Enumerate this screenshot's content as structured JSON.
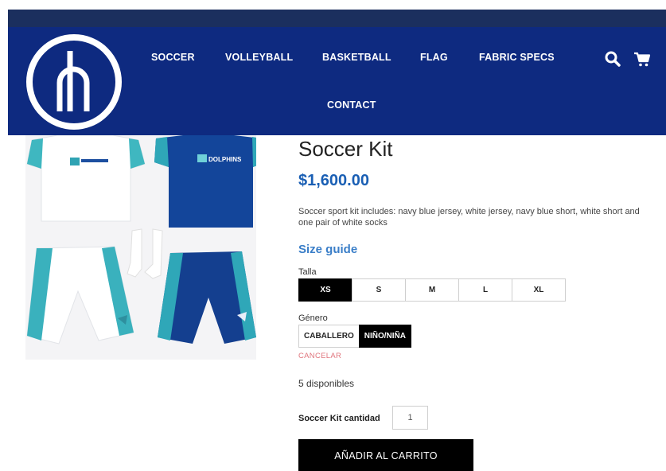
{
  "header": {
    "nav": [
      "SOCCER",
      "VOLLEYBALL",
      "BASKETBALL",
      "FLAG",
      "FABRIC SPECS",
      "CONTACT"
    ],
    "icons": [
      "search-icon",
      "cart-icon"
    ]
  },
  "product": {
    "title": "Soccer Kit",
    "price": "$1,600.00",
    "description": "Soccer sport kit includes: navy blue jersey, white jersey, navy blue short, white short and one pair of white socks",
    "image_logo_text": "DOLPHINS"
  },
  "size_guide": "Size guide",
  "talla": {
    "label": "Talla",
    "options": [
      "XS",
      "S",
      "M",
      "L",
      "XL"
    ],
    "selected": "XS"
  },
  "genero": {
    "label": "Género",
    "options": [
      "CABALLERO",
      "NIÑO/NIÑA"
    ],
    "selected": "NIÑO/NIÑA"
  },
  "cancel": "CANCELAR",
  "stock": "5 disponibles",
  "quantity": {
    "label": "Soccer Kit cantidad",
    "value": "1"
  },
  "add_to_cart": "AÑADIR AL CARRITO",
  "colors": {
    "nav_bg": "#0e2a80",
    "top_strip": "#1b2f5e",
    "price": "#1a5fb4",
    "link": "#3a7ec8",
    "cancel": "#e0757d",
    "button": "#000000"
  }
}
